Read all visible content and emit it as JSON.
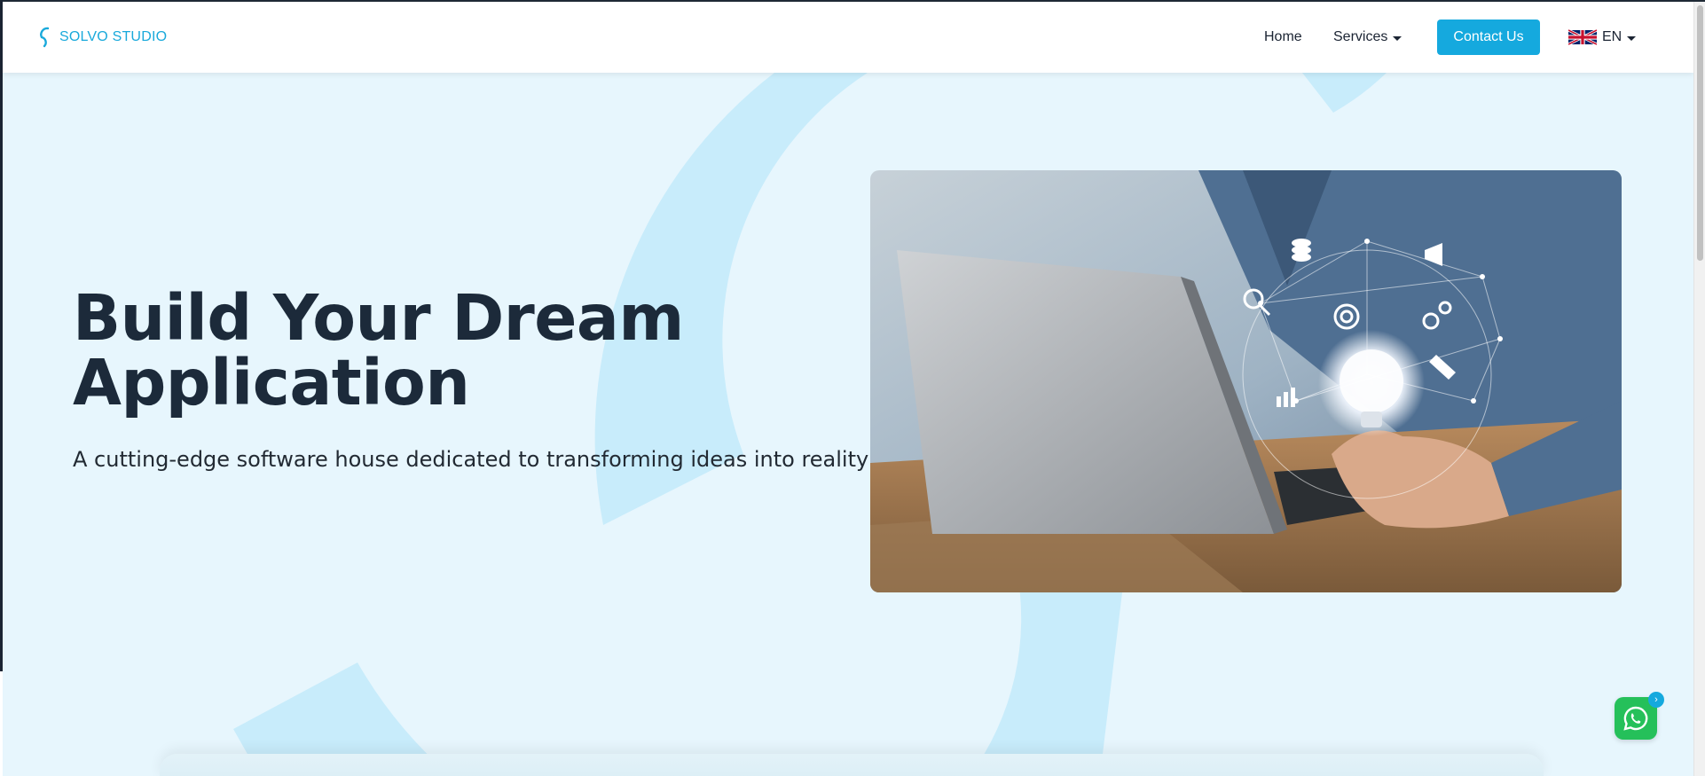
{
  "brand": {
    "name": "SOLVO STUDIO",
    "accent_color": "#19a9db",
    "logo_icon": "solvo-s-icon"
  },
  "nav": {
    "home": "Home",
    "services": "Services",
    "contact": "Contact Us",
    "language": "EN",
    "language_icon": "uk-flag-icon"
  },
  "hero": {
    "title": "Build Your Dream Application",
    "subtitle": "A cutting-edge software house dedicated to transforming ideas into reality",
    "image_alt_icon": "laptop-lightbulb-illustration"
  },
  "floating": {
    "whatsapp_icon": "whatsapp-icon",
    "badge_icon": "chevron-right-icon"
  },
  "colors": {
    "hero_background": "#e7f6fd",
    "arc": "#c8ecfb",
    "title": "#1c2a3a",
    "button": "#15a9de",
    "whatsapp": "#25c05a"
  }
}
